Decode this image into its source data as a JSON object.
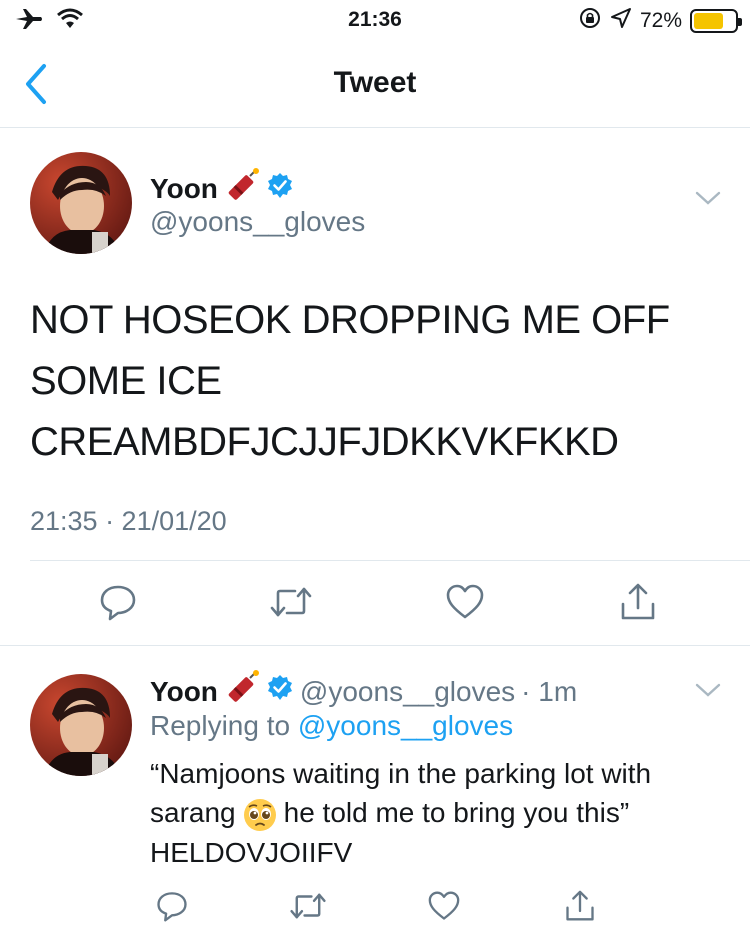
{
  "status_bar": {
    "time": "21:36",
    "battery_percent": "72%",
    "battery_level": 0.72
  },
  "nav": {
    "title": "Tweet"
  },
  "main_tweet": {
    "display_name": "Yoon",
    "handle": "@yoons__gloves",
    "text_lines": [
      "NOT HOSEOK DROPPING ME OFF",
      "SOME ICE",
      "CREAMBDFJCJJFJDKKVKFKKD"
    ],
    "timestamp": "21:35 · 21/01/20"
  },
  "reply_tweet": {
    "display_name": "Yoon",
    "handle": "@yoons__gloves",
    "age": "· 1m",
    "replying_prefix": "Replying to",
    "replying_to": "@yoons__gloves",
    "text_line1": "“Namjoons waiting in the parking lot with",
    "text_line2_a": "sarang",
    "text_line2_b": "he told me to bring you this”",
    "text_line3": "HELDOVJOIIFV"
  },
  "colors": {
    "accent": "#1da1f2",
    "muted": "#657786",
    "text": "#14171a",
    "divider": "#e1e8ed"
  }
}
